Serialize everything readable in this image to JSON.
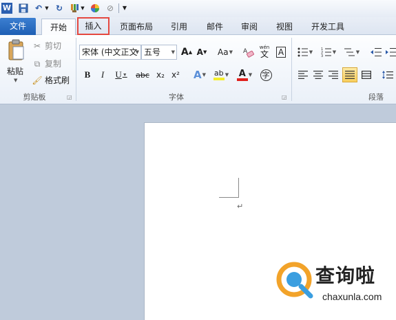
{
  "quick_access": {
    "icons": [
      "word-logo-icon",
      "save-icon",
      "undo-icon",
      "redo-icon",
      "format-painter-icon",
      "color-wheel-icon",
      "clear-icon",
      "customize-icon"
    ]
  },
  "tabs": [
    {
      "label": "文件",
      "state": "file"
    },
    {
      "label": "开始",
      "state": "active"
    },
    {
      "label": "插入",
      "state": "highlighted"
    },
    {
      "label": "页面布局"
    },
    {
      "label": "引用"
    },
    {
      "label": "邮件"
    },
    {
      "label": "审阅"
    },
    {
      "label": "视图"
    },
    {
      "label": "开发工具"
    }
  ],
  "clipboard": {
    "paste_label": "粘贴",
    "cut_label": "剪切",
    "copy_label": "复制",
    "format_painter_label": "格式刷",
    "group_label": "剪贴板"
  },
  "font": {
    "font_name": "宋体 (中文正文",
    "font_size": "五号",
    "grow": "A",
    "shrink": "A",
    "change_case": "Aa",
    "phonetic": "wén",
    "border_char": "A",
    "bold": "B",
    "italic": "I",
    "underline": "U",
    "strikethrough": "abc",
    "subscript": "x₂",
    "superscript": "x²",
    "text_effects": "A",
    "highlight": "ab",
    "font_color": "A",
    "enclose": "字",
    "group_label": "字体"
  },
  "paragraph": {
    "group_label": "段落"
  },
  "document": {
    "paragraph_mark": "↵"
  },
  "watermark": {
    "title": "查询啦",
    "url": "chaxunla.com"
  },
  "colors": {
    "accent_blue": "#2b6cc4",
    "highlight_red": "#e5473f",
    "workspace": "#bfcbdb"
  }
}
